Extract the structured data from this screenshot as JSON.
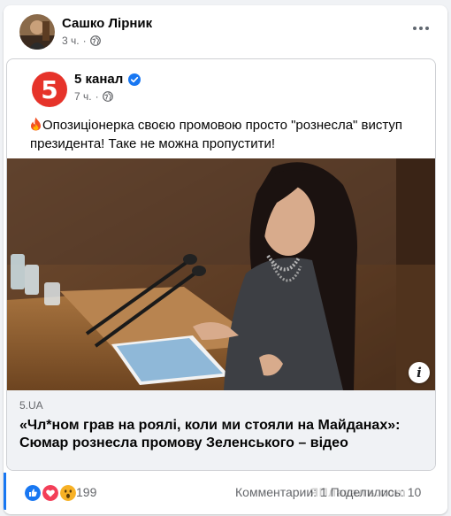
{
  "post": {
    "author": "Сашко Лірник",
    "time": "3 ч.",
    "separator": "·"
  },
  "shared": {
    "page_name": "5 канал",
    "logo_text": "5",
    "time": "7 ч.",
    "separator": "·",
    "text": "Опозиціонерка своєю промовою просто \"рознесла\" виступ президента! Таке не можна пропустити!",
    "link_domain": "5.UA",
    "link_title": "«Чл*ном грав на роялі, коли ми стояли на Майданах»: Сюмар рознесла промову Зеленського – відео",
    "info_icon": "i"
  },
  "reactions": {
    "icons": [
      "like-icon",
      "love-icon",
      "wow-icon"
    ],
    "count": "199",
    "comments_label": "Комментарии: 1  Поделились: 10",
    "watermark": "ЯПлакалъ.com"
  },
  "colors": {
    "accent": "#1877f2",
    "logo_red": "#e6332a",
    "secondary_text": "#65676b"
  }
}
